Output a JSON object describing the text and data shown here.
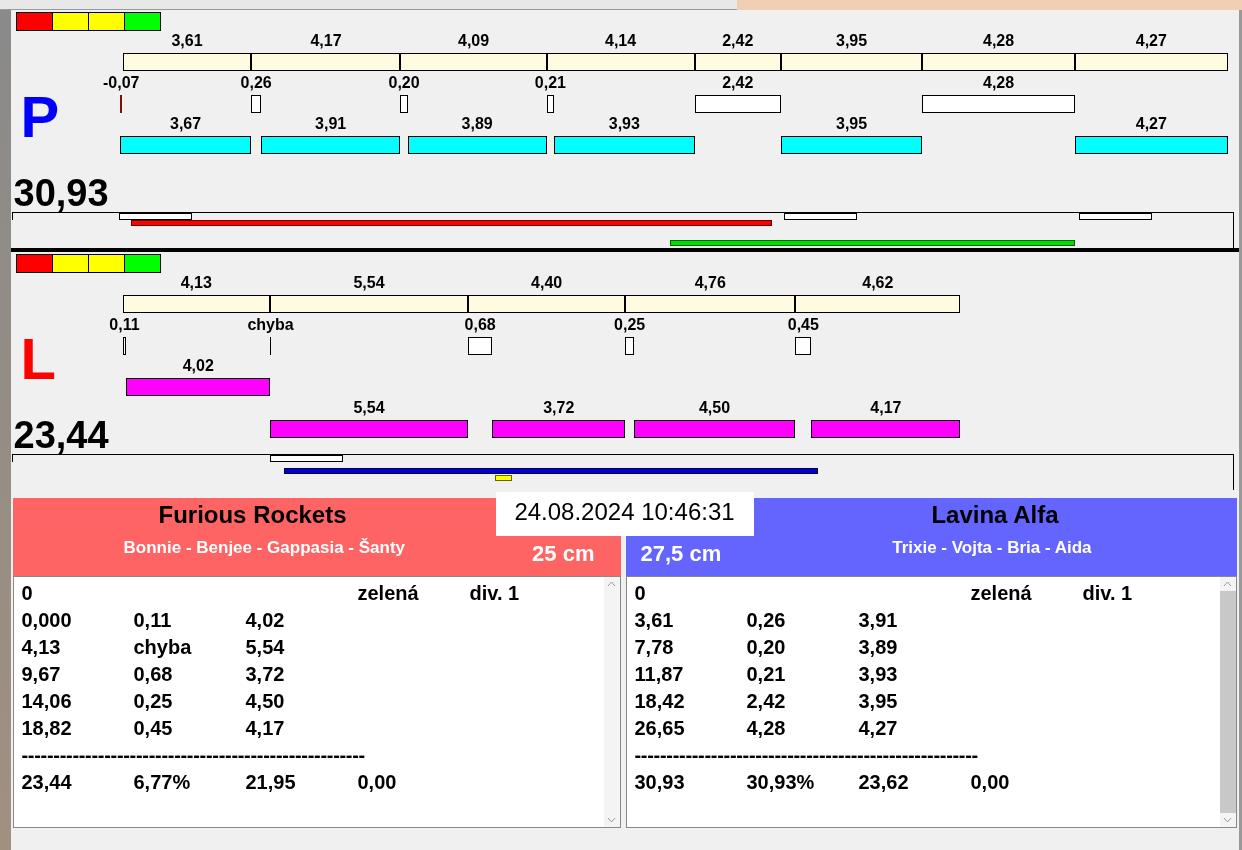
{
  "lanes": [
    {
      "letter": "P",
      "color": "#0000ff",
      "total": "30,93",
      "lights": [
        {
          "color": "#ff0000"
        },
        {
          "color": "#ffff00"
        },
        {
          "color": "#ffff00"
        },
        {
          "color": "#00ff00"
        }
      ],
      "segments": [
        {
          "label": "3,61",
          "gap": {
            "label": "-0,07",
            "kind": "over"
          },
          "run": {
            "label": "3,67",
            "color": "#00ffff"
          }
        },
        {
          "label": "4,17",
          "gap": {
            "label": "0,26",
            "kind": "pause"
          },
          "run": {
            "label": "3,91",
            "color": "#00ffff"
          }
        },
        {
          "label": "4,09",
          "gap": {
            "label": "0,20",
            "kind": "pause"
          },
          "run": {
            "label": "3,89",
            "color": "#00ffff"
          }
        },
        {
          "label": "4,14",
          "gap": {
            "label": "0,21",
            "kind": "pause"
          },
          "run": {
            "label": "3,93",
            "color": "#00ffff"
          }
        },
        {
          "label": "2,42",
          "gap": {
            "label": "2,42",
            "kind": "pause"
          }
        },
        {
          "label": "3,95",
          "run": {
            "label": "3,95",
            "color": "#00ffff"
          }
        },
        {
          "label": "4,28",
          "gap": {
            "label": "4,28",
            "kind": "pause"
          }
        },
        {
          "label": "4,27",
          "run": {
            "label": "4,27",
            "color": "#00ffff"
          }
        }
      ]
    },
    {
      "letter": "L",
      "color": "#ff0000",
      "total": "23,44",
      "lights": [
        {
          "color": "#ff0000"
        },
        {
          "color": "#ffff00"
        },
        {
          "color": "#ffff00"
        },
        {
          "color": "#00ff00"
        }
      ],
      "segments": [
        {
          "label": "4,13",
          "gap": {
            "label": "0,11",
            "kind": "pause"
          },
          "run": {
            "label": "4,02",
            "color": "#ff00ff"
          }
        },
        {
          "label": "5,54",
          "gap": {
            "label": "chyba",
            "kind": "error"
          },
          "lower_run": {
            "label": "5,54",
            "color": "#ff00ff"
          }
        },
        {
          "label": "4,40",
          "gap": {
            "label": "0,68",
            "kind": "pause"
          },
          "lower_run": {
            "label": "3,72",
            "color": "#ff00ff"
          }
        },
        {
          "label": "4,76",
          "gap": {
            "label": "0,25",
            "kind": "pause"
          },
          "lower_run": {
            "label": "4,50",
            "color": "#ff00ff"
          }
        },
        {
          "label": "4,62",
          "gap": {
            "label": "0,45",
            "kind": "pause"
          },
          "lower_run": {
            "label": "4,17",
            "color": "#ff00ff"
          }
        }
      ]
    }
  ],
  "timestamp": "24.08.2024 10:46:31",
  "teams": [
    {
      "name": "Furious Rockets",
      "members": "Bonnie - Benjee - Gappasia - Šanty",
      "distance": "25 cm",
      "color": "#ff6464",
      "log": {
        "header": {
          "count": "0",
          "color_name": "zelená",
          "division": "div. 1"
        },
        "rows": [
          [
            "0,000",
            "0,11",
            "4,02"
          ],
          [
            "4,13",
            "chyba",
            "5,54"
          ],
          [
            "9,67",
            "0,68",
            "3,72"
          ],
          [
            "14,06",
            "0,25",
            "4,50"
          ],
          [
            "18,82",
            "0,45",
            "4,17"
          ]
        ],
        "separator": "------------------------------------------------------",
        "summary": [
          "23,44",
          "6,77%",
          "21,95",
          "0,00"
        ]
      }
    },
    {
      "name": "Lavina Alfa",
      "members": "Trixie - Vojta - Bria - Aida",
      "distance": "27,5 cm",
      "color": "#6464ff",
      "log": {
        "header": {
          "count": "0",
          "color_name": "zelená",
          "division": "div. 1"
        },
        "rows": [
          [
            "3,61",
            "0,26",
            "3,91"
          ],
          [
            "7,78",
            "0,20",
            "3,89"
          ],
          [
            "11,87",
            "0,21",
            "3,93"
          ],
          [
            "18,42",
            "2,42",
            "3,95"
          ],
          [
            "26,65",
            "4,28",
            "4,27"
          ]
        ],
        "separator": "------------------------------------------------------",
        "summary": [
          "30,93",
          "30,93%",
          "23,62",
          "0,00"
        ]
      }
    }
  ]
}
